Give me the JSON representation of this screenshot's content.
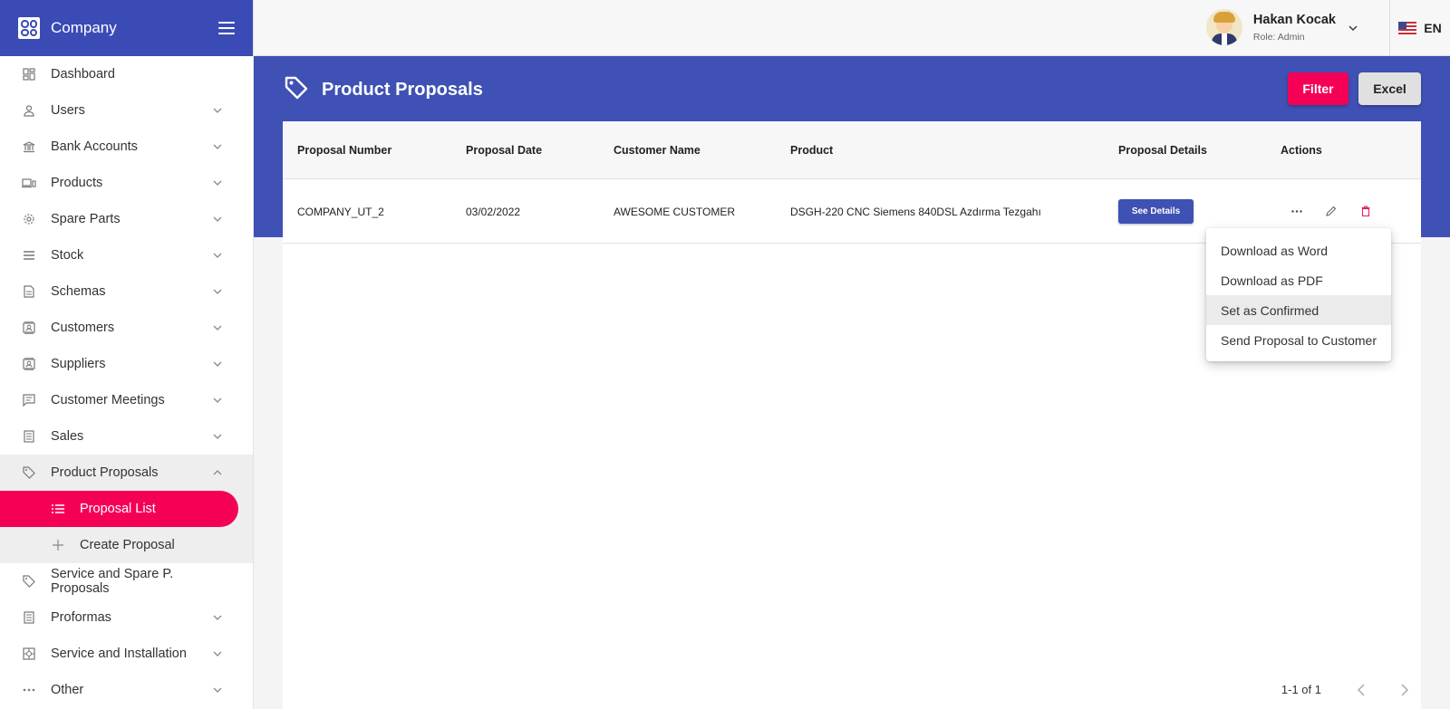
{
  "brand": {
    "name": "Company"
  },
  "sidebar": {
    "items": [
      {
        "label": "Dashboard",
        "icon": "dashboard-icon"
      },
      {
        "label": "Users",
        "icon": "person-icon"
      },
      {
        "label": "Bank Accounts",
        "icon": "bank-icon"
      },
      {
        "label": "Products",
        "icon": "devices-icon"
      },
      {
        "label": "Spare Parts",
        "icon": "gear-icon"
      },
      {
        "label": "Stock",
        "icon": "list-icon"
      },
      {
        "label": "Schemas",
        "icon": "document-icon"
      },
      {
        "label": "Customers",
        "icon": "contact-icon"
      },
      {
        "label": "Suppliers",
        "icon": "contact-icon"
      },
      {
        "label": "Customer Meetings",
        "icon": "chat-icon"
      },
      {
        "label": "Sales",
        "icon": "receipt-icon"
      },
      {
        "label": "Product Proposals",
        "icon": "tag-icon"
      },
      {
        "label": "Service and Spare P. Proposals",
        "icon": "tag-icon"
      },
      {
        "label": "Proformas",
        "icon": "receipt-icon"
      },
      {
        "label": "Service and Installation",
        "icon": "install-icon"
      },
      {
        "label": "Other",
        "icon": "more-icon"
      }
    ],
    "sub_items": [
      {
        "label": "Proposal List",
        "icon": "list-icon"
      },
      {
        "label": "Create Proposal",
        "icon": "plus-icon"
      }
    ]
  },
  "user": {
    "name": "Hakan Kocak",
    "role": "Role: Admin"
  },
  "language": {
    "code": "EN"
  },
  "page": {
    "title": "Product Proposals",
    "filter_label": "Filter",
    "excel_label": "Excel"
  },
  "table": {
    "headers": [
      "Proposal Number",
      "Proposal Date",
      "Customer Name",
      "Product",
      "Proposal Details",
      "Actions"
    ],
    "rows": [
      {
        "number": "COMPANY_UT_2",
        "date": "03/02/2022",
        "customer": "AWESOME CUSTOMER",
        "product": "DSGH-220 CNC Siemens 840DSL Azdırma Tezgahı",
        "details_label": "See Details"
      }
    ]
  },
  "pagination": {
    "text": "1-1 of 1"
  },
  "actions_menu": {
    "items": [
      "Download as Word",
      "Download as PDF",
      "Set as Confirmed",
      "Send Proposal to Customer"
    ]
  },
  "colors": {
    "primary": "#3f51b5",
    "accent": "#f50057"
  }
}
